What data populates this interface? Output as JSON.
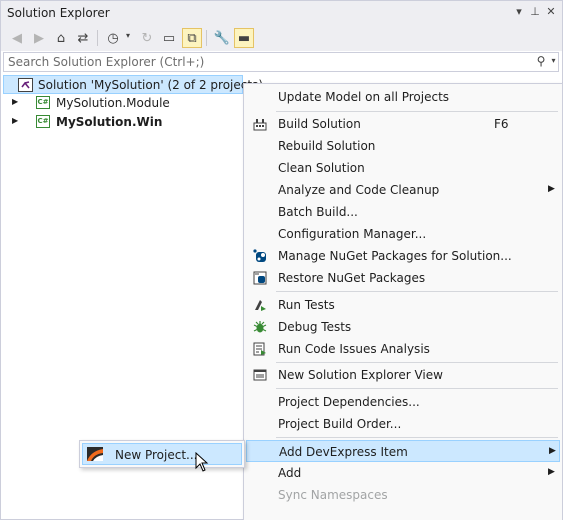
{
  "titlebar": {
    "title": "Solution Explorer",
    "dropdown_glyph": "▾",
    "pin_glyph": "⊥",
    "close_glyph": "✕"
  },
  "toolbar": {
    "back_glyph": "◀",
    "forward_glyph": "▶",
    "home_glyph": "⌂",
    "switch_views_glyph": "⇄",
    "pending_changes_glyph": "◷",
    "sync_glyph": "↻",
    "collapse_all_glyph": "▭",
    "show_all_files_glyph": "⧉",
    "properties_glyph": "🔧",
    "preview_glyph": "▬",
    "caret_glyph": "▾"
  },
  "search": {
    "placeholder": "Search Solution Explorer (Ctrl+;)",
    "icon_glyph": "⚲",
    "dropdown_glyph": "▾"
  },
  "tree": {
    "solution_label": "Solution 'MySolution' (2 of 2 projects)",
    "projects": [
      {
        "label": "MySolution.Module",
        "icon_text": "C#",
        "bold": false
      },
      {
        "label": "MySolution.Win",
        "icon_text": "C#",
        "bold": true
      }
    ],
    "expander_glyph": "▶"
  },
  "context_menu": {
    "items": [
      {
        "label": "Update Model on all Projects",
        "shortcut": "",
        "submenu": false,
        "icon": ""
      },
      {
        "label": "Build Solution",
        "shortcut": "F6",
        "submenu": false,
        "icon": "build-icon"
      },
      {
        "label": "Rebuild Solution",
        "shortcut": "",
        "submenu": false,
        "icon": ""
      },
      {
        "label": "Clean Solution",
        "shortcut": "",
        "submenu": false,
        "icon": ""
      },
      {
        "label": "Analyze and Code Cleanup",
        "shortcut": "",
        "submenu": true,
        "icon": ""
      },
      {
        "label": "Batch Build...",
        "shortcut": "",
        "submenu": false,
        "icon": ""
      },
      {
        "label": "Configuration Manager...",
        "shortcut": "",
        "submenu": false,
        "icon": ""
      },
      {
        "label": "Manage NuGet Packages for Solution...",
        "shortcut": "",
        "submenu": false,
        "icon": "nuget-icon"
      },
      {
        "label": "Restore NuGet Packages",
        "shortcut": "",
        "submenu": false,
        "icon": "restore-icon"
      },
      {
        "label": "Run Tests",
        "shortcut": "",
        "submenu": false,
        "icon": "run-tests-icon"
      },
      {
        "label": "Debug Tests",
        "shortcut": "",
        "submenu": false,
        "icon": "debug-tests-icon"
      },
      {
        "label": "Run Code Issues Analysis",
        "shortcut": "",
        "submenu": false,
        "icon": "code-analysis-icon"
      },
      {
        "label": "New Solution Explorer View",
        "shortcut": "",
        "submenu": false,
        "icon": "new-view-icon"
      },
      {
        "label": "Project Dependencies...",
        "shortcut": "",
        "submenu": false,
        "icon": ""
      },
      {
        "label": "Project Build Order...",
        "shortcut": "",
        "submenu": false,
        "icon": ""
      },
      {
        "label": "Add DevExpress Item",
        "shortcut": "",
        "submenu": true,
        "icon": ""
      },
      {
        "label": "Add",
        "shortcut": "",
        "submenu": true,
        "icon": ""
      },
      {
        "label": "Sync Namespaces",
        "shortcut": "",
        "submenu": false,
        "icon": ""
      }
    ],
    "arrow_glyph": "▶",
    "highlighted_item": "Add DevExpress Item",
    "disabled_item": "Sync Namespaces"
  },
  "submenu": {
    "item_label": "New Project..."
  },
  "colors": {
    "highlight": "#cce8ff",
    "highlight_border": "#99d1ff",
    "toolbar_bg": "#eeeef2",
    "menu_bg": "#f9f9f9",
    "csharp_green": "#388a34",
    "vs_purple": "#68217a"
  }
}
